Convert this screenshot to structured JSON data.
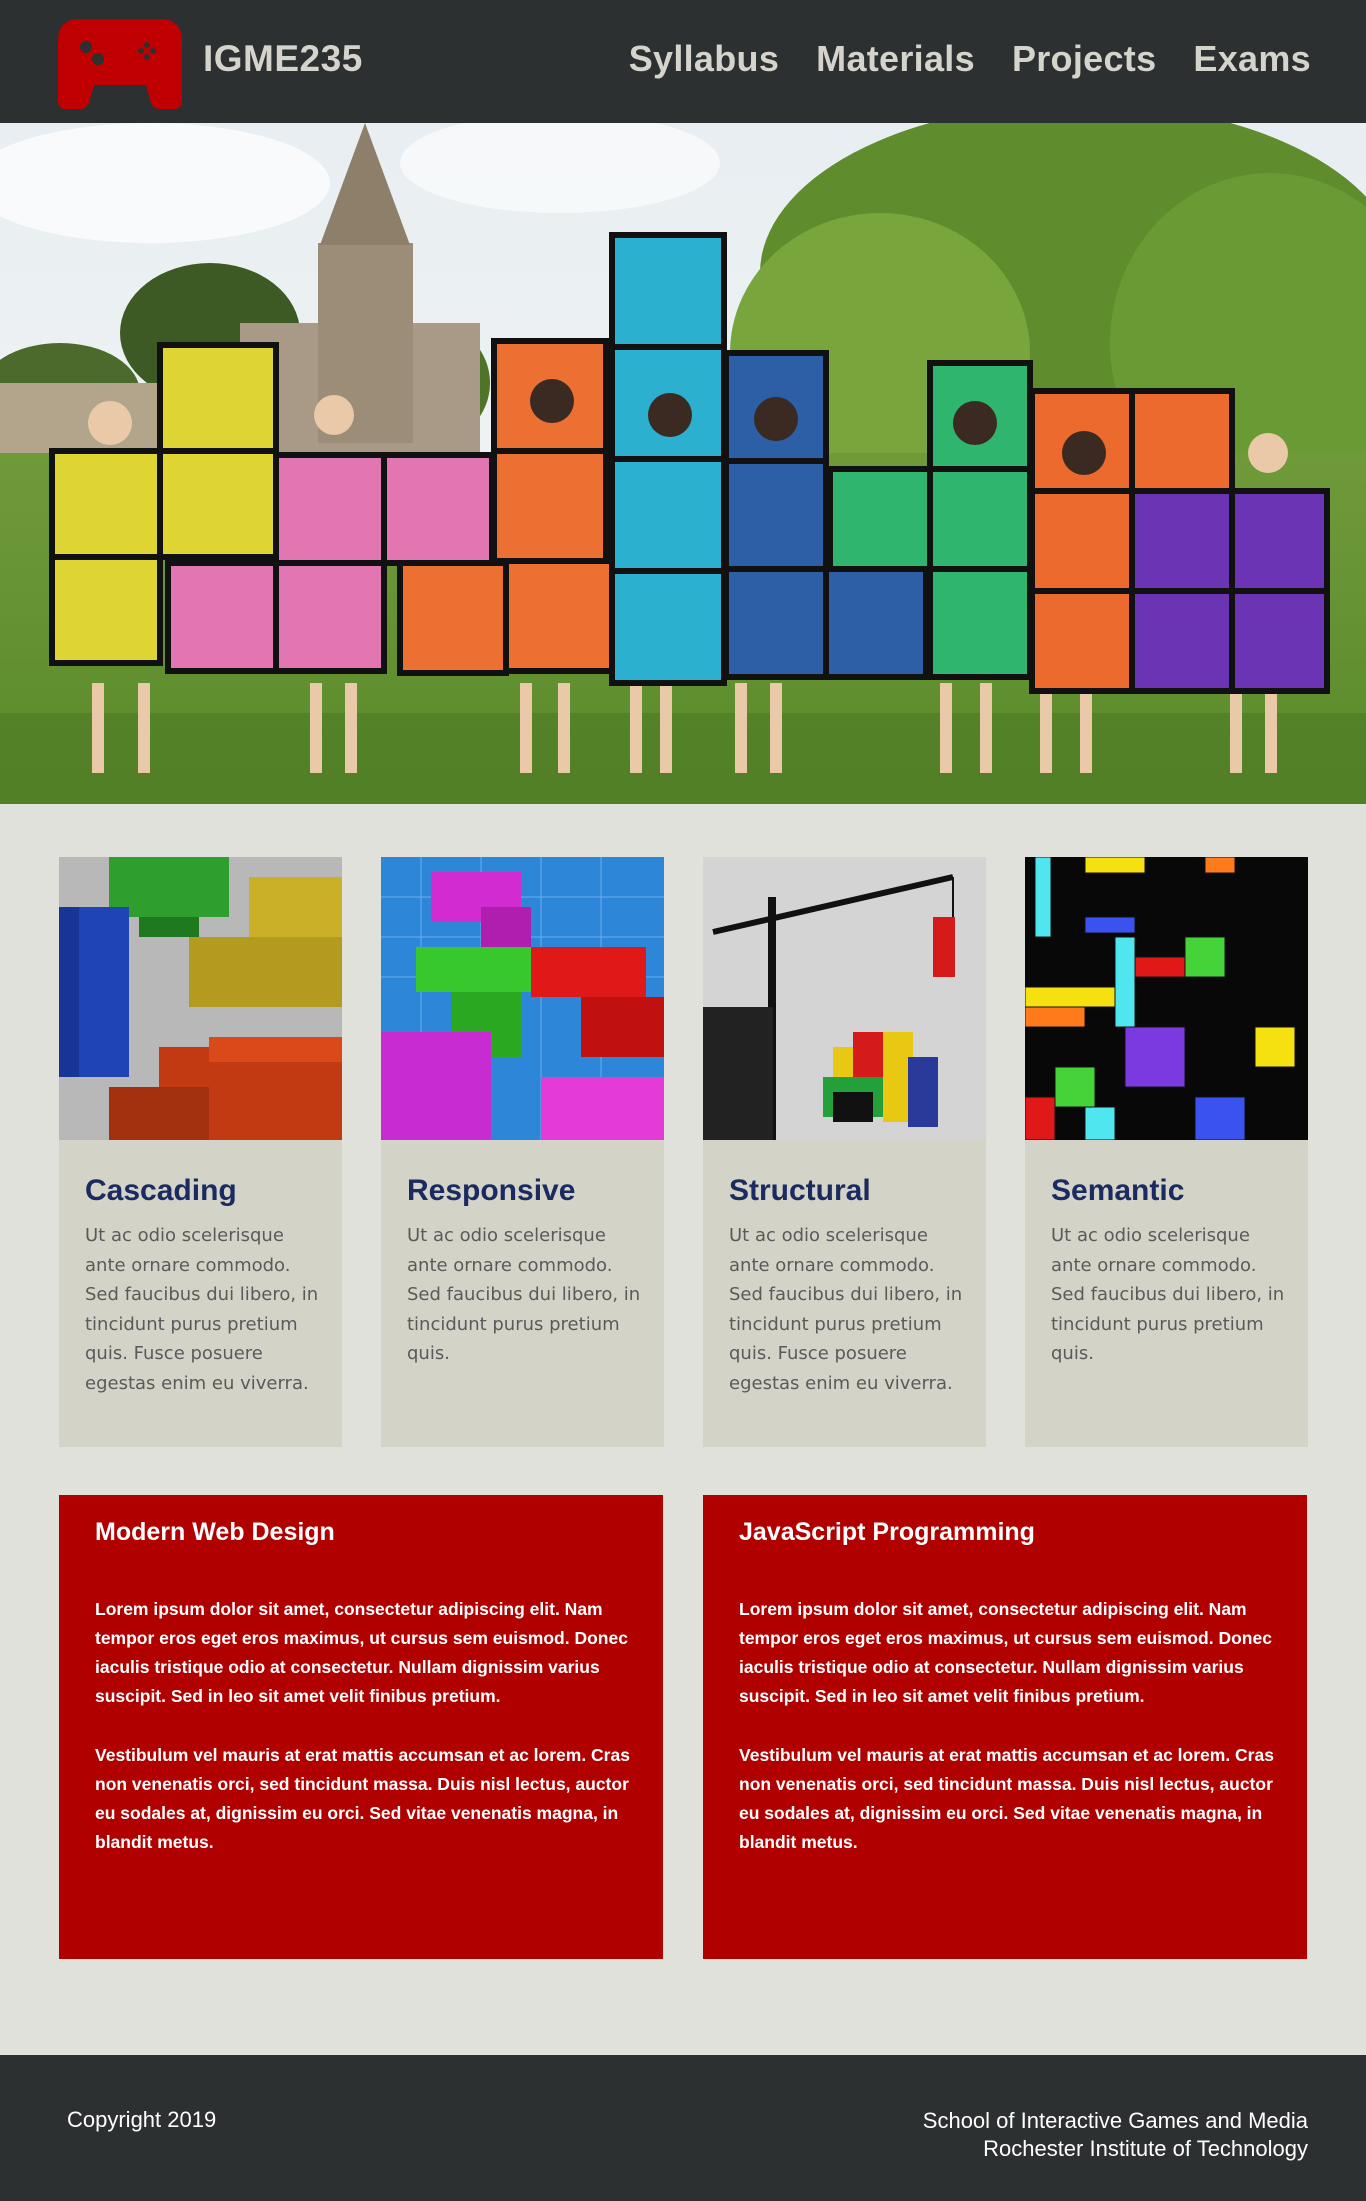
{
  "header": {
    "title": "IGME235",
    "logo_icon": "gamepad-icon",
    "nav": [
      "Syllabus",
      "Materials",
      "Projects",
      "Exams"
    ]
  },
  "colors": {
    "header_bg": "#2c3030",
    "page_bg": "#e1e1dc",
    "card_bg": "#d3d4c7",
    "card_heading": "#1b2a60",
    "panel_bg": "#b10000",
    "logo": "#c00000"
  },
  "cards": [
    {
      "title": "Cascading",
      "text": "Ut ac odio scelerisque ante ornare commodo. Sed faucibus dui libero, in tincidunt purus pretium quis. Fusce posuere egestas enim eu viverra."
    },
    {
      "title": "Responsive",
      "text": "Ut ac odio scelerisque ante ornare commodo. Sed faucibus dui libero, in tincidunt purus pretium quis."
    },
    {
      "title": "Structural",
      "text": "Ut ac odio scelerisque ante ornare commodo. Sed faucibus dui libero, in tincidunt purus pretium quis. Fusce posuere egestas enim eu viverra."
    },
    {
      "title": "Semantic",
      "text": "Ut ac odio scelerisque ante ornare commodo. Sed faucibus dui libero, in tincidunt purus pretium quis."
    }
  ],
  "panels": [
    {
      "title": "Modern Web Design",
      "p1": "Lorem ipsum dolor sit amet, consectetur adipiscing elit. Nam tempor eros eget eros maximus, ut cursus sem euismod. Donec iaculis tristique odio at consectetur. Nullam dignissim varius suscipit. Sed in leo sit amet velit finibus pretium.",
      "p2": "Vestibulum vel mauris at erat mattis accumsan et ac lorem. Cras non venenatis orci, sed tincidunt massa. Duis nisl lectus, auctor eu sodales at, dignissim eu orci. Sed vitae venenatis magna, in blandit metus."
    },
    {
      "title": "JavaScript Programming",
      "p1": "Lorem ipsum dolor sit amet, consectetur adipiscing elit. Nam tempor eros eget eros maximus, ut cursus sem euismod. Donec iaculis tristique odio at consectetur. Nullam dignissim varius suscipit. Sed in leo sit amet velit finibus pretium.",
      "p2": "Vestibulum vel mauris at erat mattis accumsan et ac lorem. Cras non venenatis orci, sed tincidunt massa. Duis nisl lectus, auctor eu sodales at, dignissim eu orci. Sed vitae venenatis magna, in blandit metus."
    }
  ],
  "footer": {
    "copyright": "Copyright 2019",
    "school_line1": "School of Interactive Games and Media",
    "school_line2": "Rochester Institute of Technology"
  }
}
